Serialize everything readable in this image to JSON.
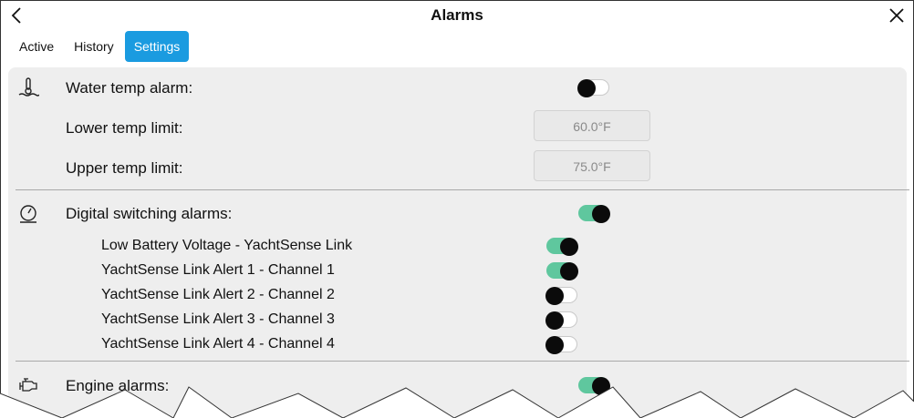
{
  "header": {
    "title": "Alarms",
    "back_icon": "back-chevron-icon",
    "close_icon": "close-icon"
  },
  "tabs": [
    {
      "label": "Active",
      "active": false
    },
    {
      "label": "History",
      "active": false
    },
    {
      "label": "Settings",
      "active": true
    }
  ],
  "water_temp": {
    "icon": "water-temperature-icon",
    "label": "Water temp alarm:",
    "enabled": false,
    "lower_label": "Lower temp limit:",
    "lower_value": "60.0°F",
    "upper_label": "Upper temp limit:",
    "upper_value": "75.0°F"
  },
  "digital_switching": {
    "icon": "gauge-icon",
    "label": "Digital switching alarms:",
    "enabled": true,
    "items": [
      {
        "label": "Low Battery Voltage - YachtSense Link",
        "enabled": true
      },
      {
        "label": "YachtSense Link Alert 1 - Channel 1",
        "enabled": true
      },
      {
        "label": "YachtSense Link Alert 2 - Channel 2",
        "enabled": false
      },
      {
        "label": "YachtSense Link Alert 3 - Channel 3",
        "enabled": false
      },
      {
        "label": "YachtSense Link Alert 4 - Channel 4",
        "enabled": false
      }
    ]
  },
  "engine": {
    "icon": "engine-icon",
    "label": "Engine alarms:",
    "enabled": true
  },
  "colors": {
    "accent": "#1a9be0",
    "toggle_on": "#5fc79e",
    "panel_bg": "#eeeeee"
  }
}
